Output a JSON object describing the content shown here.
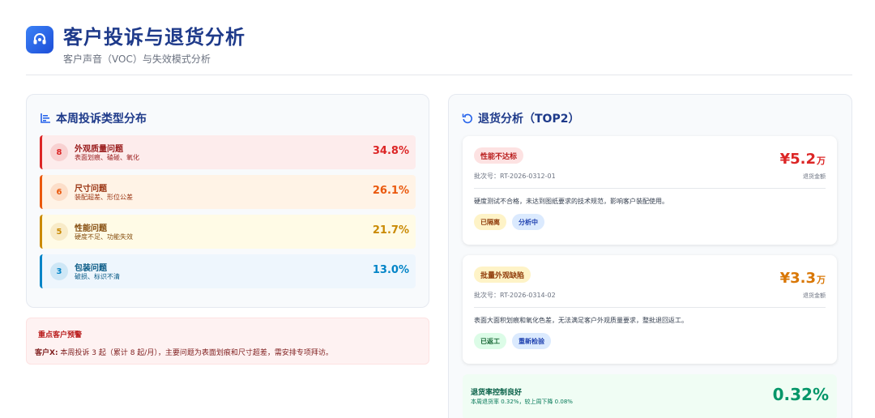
{
  "header": {
    "title": "客户投诉与退货分析",
    "subtitle": "客户声音（VOC）与失效模式分析",
    "icon": "headset-icon"
  },
  "complaints": {
    "title": "本周投诉类型分布",
    "icon": "bar-chart-icon",
    "items": [
      {
        "count": "8",
        "name": "外观质量问题",
        "desc": "表面划痕、磕碰、氧化",
        "percent": "34.8%",
        "color": "#dc2626",
        "bg": "#fdecec"
      },
      {
        "count": "6",
        "name": "尺寸问题",
        "desc": "装配超差、形位公差",
        "percent": "26.1%",
        "color": "#ea580c",
        "bg": "#fff3e6"
      },
      {
        "count": "5",
        "name": "性能问题",
        "desc": "硬度不足、功能失效",
        "percent": "21.7%",
        "color": "#ca8a04",
        "bg": "#fffbe6"
      },
      {
        "count": "3",
        "name": "包装问题",
        "desc": "破损、标识不清",
        "percent": "13.0%",
        "color": "#0284c7",
        "bg": "#eef6fd"
      }
    ]
  },
  "warning": {
    "title": "重点客户预警",
    "customer": "客户X:",
    "text": " 本周投诉 3 起（累计 8 起/月），主要问题为表面划痕和尺寸超差，需安排专项拜访。"
  },
  "returns": {
    "title": "退货分析（TOP2）",
    "icon": "refresh-icon",
    "items": [
      {
        "badge": "性能不达标",
        "batch": "批次号：RT-2026-0312-01",
        "amount": "¥5.2",
        "unit": "万",
        "amount_label": "退货金额",
        "desc": "硬度测试不合格，未达到图纸要求的技术规范，影响客户装配使用。",
        "tags": [
          "已隔离",
          "分析中"
        ],
        "color": "#dc2626"
      },
      {
        "badge": "批量外观缺陷",
        "batch": "批次号：RT-2026-0314-02",
        "amount": "¥3.3",
        "unit": "万",
        "amount_label": "退货金额",
        "desc": "表面大面积划痕和氧化色差，无法满足客户外观质量要求，整批退回返工。",
        "tags": [
          "已返工",
          "重新检验"
        ],
        "color": "#d97706"
      }
    ],
    "summary": {
      "title": "退货率控制良好",
      "desc": "本周退货率 0.32%，较上周下降 0.08%",
      "value": "0.32%"
    }
  }
}
